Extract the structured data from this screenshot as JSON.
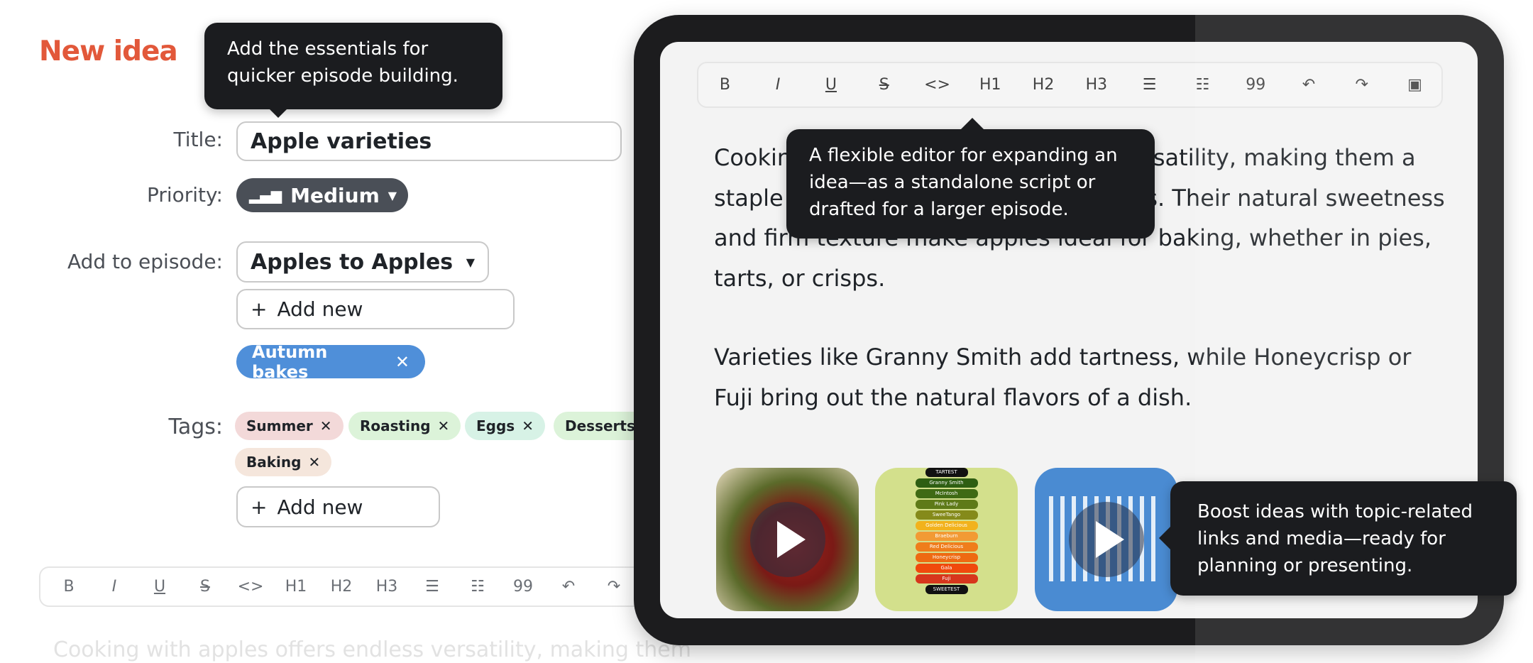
{
  "form": {
    "heading": "New idea",
    "tooltip": "Add the essentials for quicker episode building.",
    "title_label": "Title:",
    "title_value": "Apple varieties",
    "priority_label": "Priority:",
    "priority_value": "Medium",
    "episode_label": "Add to episode:",
    "episode_value": "Apples to Apples",
    "episode_add": "Add new",
    "episode_chip": "Autumn bakes",
    "tags_label": "Tags:",
    "tags": [
      {
        "label": "Summer",
        "color": "#f3d9d9"
      },
      {
        "label": "Roasting",
        "color": "#dcf3d9"
      },
      {
        "label": "Eggs",
        "color": "#d7f2e6"
      },
      {
        "label": "Desserts",
        "color": "#dcf3d9"
      },
      {
        "label": "Baking",
        "color": "#f5e6dc"
      }
    ],
    "tags_add": "Add new",
    "body_preview": "Cooking with apples offers endless versatility, making them"
  },
  "toolbar": {
    "bold": "B",
    "italic": "I",
    "underline": "U",
    "strike": "S",
    "code": "<>",
    "h1": "H1",
    "h2": "H2",
    "h3": "H3",
    "bullets": "☰",
    "numbered": "☷",
    "quote": "99",
    "undo": "↶",
    "redo": "↷",
    "image": "▣"
  },
  "editor": {
    "tooltip": "A flexible editor for expanding an idea—as a standalone script or drafted for a larger episode.",
    "paragraph1": "Cooking with apples offers endless versatility, making them a staple in both savory and sweet dishes. Their natural sweetness and firm texture make apples ideal for baking, whether in pies, tarts, or crisps.",
    "paragraph2": "Varieties like Granny Smith add tartness, while Honeycrisp or Fuji bring out the natural flavors of a dish.",
    "media_tooltip": "Boost ideas with topic-related links and media—ready for planning or presenting.",
    "chart_top": "TARTEST",
    "chart_bottom": "SWEETEST",
    "varieties": [
      {
        "name": "Granny Smith",
        "color": "#2e5e12"
      },
      {
        "name": "McIntosh",
        "color": "#3f6a14"
      },
      {
        "name": "Pink Lady",
        "color": "#5e7a18"
      },
      {
        "name": "SweeTango",
        "color": "#858a1a"
      },
      {
        "name": "Golden Delicious",
        "color": "#f2b21c"
      },
      {
        "name": "Braeburn",
        "color": "#f29a34"
      },
      {
        "name": "Red Delicious",
        "color": "#ef7d1c"
      },
      {
        "name": "Honeycrisp",
        "color": "#ee6a12"
      },
      {
        "name": "Gala",
        "color": "#f0490c"
      },
      {
        "name": "Fuji",
        "color": "#d7361c"
      }
    ]
  },
  "colors": {
    "accent": "#e2583a",
    "chip": "#4f8fd9",
    "priority": "#4a4f57",
    "tooltip": "#1b1c1f"
  }
}
